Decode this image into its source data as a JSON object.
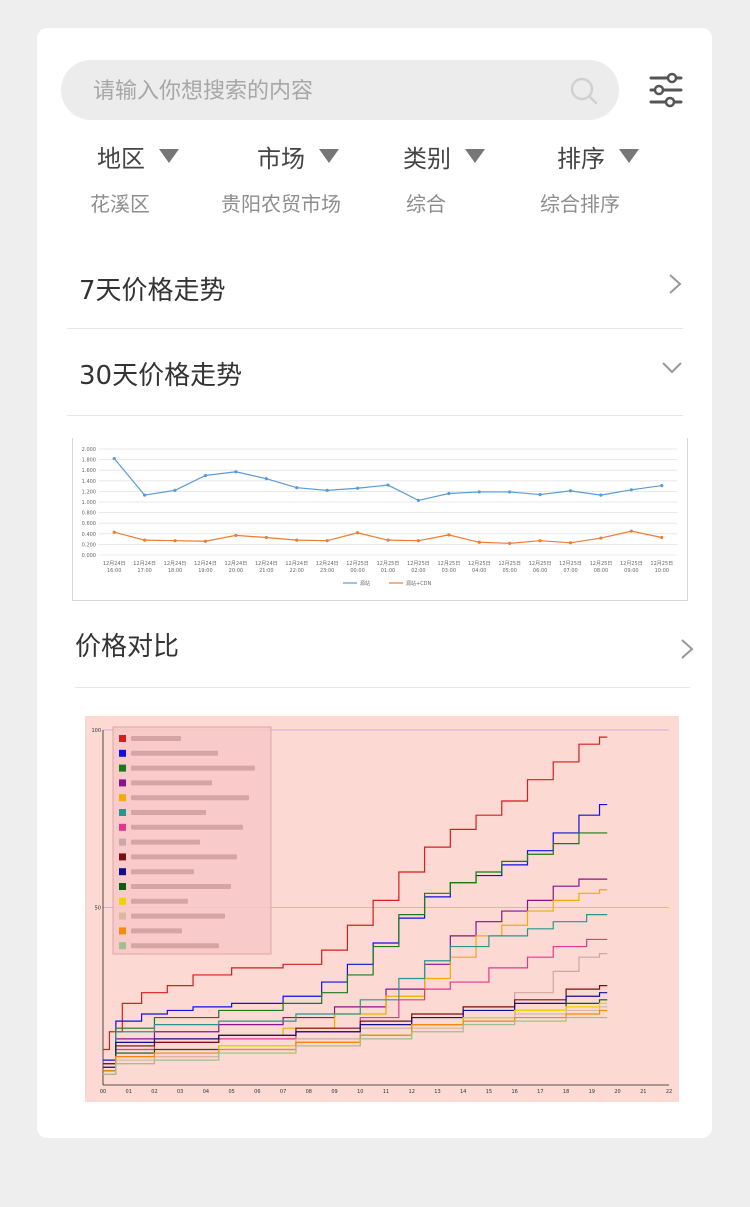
{
  "search": {
    "placeholder": "请输入你想搜索的内容"
  },
  "filters": [
    {
      "label": "地区",
      "value": "花溪区"
    },
    {
      "label": "市场",
      "value": "贵阳农贸市场"
    },
    {
      "label": "类别",
      "value": "综合"
    },
    {
      "label": "排序",
      "value": "综合排序"
    }
  ],
  "sections": {
    "seven_day": "7天价格走势",
    "thirty_day": "30天价格走势",
    "compare": "价格对比"
  },
  "colors": {
    "line_blue": "#5b9bd5",
    "line_orange": "#ed7d31",
    "chart2_bg": "#fcdad3"
  },
  "chart_data": [
    {
      "type": "line",
      "categories": [
        "12月24日 16:00",
        "12月24日 17:00",
        "12月24日 18:00",
        "12月24日 19:00",
        "12月24日 20:00",
        "12月24日 21:00",
        "12月24日 22:00",
        "12月24日 23:00",
        "12月25日 00:00",
        "12月25日 01:00",
        "12月25日 02:00",
        "12月25日 03:00",
        "12月25日 04:00",
        "12月25日 05:00",
        "12月25日 06:00",
        "12月25日 07:00",
        "12月25日 08:00",
        "12月25日 09:00",
        "12月25日 10:00"
      ],
      "yticks": [
        "2.000",
        "1.800",
        "1.600",
        "1.400",
        "1.200",
        "1.000",
        "0.800",
        "0.600",
        "0.400",
        "0.200",
        "0.000"
      ],
      "ylim": [
        0,
        2.0
      ],
      "series": [
        {
          "name": "源站",
          "color": "#5b9bd5",
          "values": [
            1.82,
            1.13,
            1.22,
            1.5,
            1.57,
            1.44,
            1.27,
            1.22,
            1.26,
            1.32,
            1.03,
            1.16,
            1.19,
            1.19,
            1.14,
            1.21,
            1.13,
            1.23,
            1.31
          ]
        },
        {
          "name": "源站+CDN",
          "color": "#ed7d31",
          "values": [
            0.43,
            0.28,
            0.27,
            0.26,
            0.37,
            0.33,
            0.28,
            0.27,
            0.42,
            0.28,
            0.27,
            0.38,
            0.24,
            0.22,
            0.27,
            0.23,
            0.32,
            0.45,
            0.33
          ]
        }
      ],
      "legend_position": "bottom"
    },
    {
      "type": "line",
      "xticks": [
        "00",
        "01",
        "02",
        "03",
        "04",
        "05",
        "06",
        "07",
        "08",
        "09",
        "10",
        "11",
        "12",
        "13",
        "14",
        "15",
        "16",
        "17",
        "18",
        "19",
        "20",
        "21",
        "22"
      ],
      "yticks": [
        "100",
        "50"
      ],
      "xlim": [
        0,
        22
      ],
      "ylim": [
        0,
        100
      ],
      "legend_position": "top-left",
      "series": [
        {
          "color": "#d21f1f",
          "values": [
            [
              0,
              10
            ],
            [
              0.5,
              15
            ],
            [
              1,
              23
            ],
            [
              2,
              26
            ],
            [
              3,
              28
            ],
            [
              4,
              31
            ],
            [
              6,
              33
            ],
            [
              8,
              34
            ],
            [
              9,
              38
            ],
            [
              10,
              45
            ],
            [
              11,
              52
            ],
            [
              12,
              60
            ],
            [
              13,
              67
            ],
            [
              14,
              72
            ],
            [
              15,
              76
            ],
            [
              16,
              80
            ],
            [
              17,
              86
            ],
            [
              18,
              91
            ],
            [
              19,
              96
            ],
            [
              19.6,
              98
            ]
          ]
        },
        {
          "color": "#1010e0",
          "values": [
            [
              0,
              7
            ],
            [
              1,
              18
            ],
            [
              2,
              20
            ],
            [
              3,
              21
            ],
            [
              4,
              22
            ],
            [
              6,
              23
            ],
            [
              8,
              25
            ],
            [
              9,
              29
            ],
            [
              10,
              34
            ],
            [
              11,
              40
            ],
            [
              12,
              47
            ],
            [
              13,
              53
            ],
            [
              14,
              57
            ],
            [
              15,
              59
            ],
            [
              16,
              62
            ],
            [
              17,
              66
            ],
            [
              18,
              71
            ],
            [
              19,
              76
            ],
            [
              19.6,
              79
            ]
          ]
        },
        {
          "color": "#1a7a1a",
          "values": [
            [
              0,
              6
            ],
            [
              1,
              16
            ],
            [
              3,
              19
            ],
            [
              6,
              21
            ],
            [
              8,
              23
            ],
            [
              9,
              26
            ],
            [
              10,
              31
            ],
            [
              11,
              39
            ],
            [
              12,
              48
            ],
            [
              13,
              54
            ],
            [
              14,
              57
            ],
            [
              15,
              60
            ],
            [
              16,
              63
            ],
            [
              17,
              65
            ],
            [
              18,
              68
            ],
            [
              19,
              71
            ],
            [
              19.6,
              71
            ]
          ]
        },
        {
          "color": "#8a128a",
          "values": [
            [
              0,
              6
            ],
            [
              1,
              13
            ],
            [
              3,
              15
            ],
            [
              6,
              17
            ],
            [
              8,
              19
            ],
            [
              10,
              22
            ],
            [
              12,
              27
            ],
            [
              13,
              34
            ],
            [
              14,
              42
            ],
            [
              15,
              46
            ],
            [
              16,
              49
            ],
            [
              17,
              52
            ],
            [
              18,
              56
            ],
            [
              19,
              58
            ],
            [
              19.6,
              58
            ]
          ]
        },
        {
          "color": "#f2ad00",
          "values": [
            [
              0,
              5
            ],
            [
              1,
              11
            ],
            [
              3,
              13
            ],
            [
              6,
              14
            ],
            [
              8,
              16
            ],
            [
              10,
              20
            ],
            [
              12,
              25
            ],
            [
              13,
              30
            ],
            [
              14,
              36
            ],
            [
              15,
              42
            ],
            [
              16,
              45
            ],
            [
              17,
              49
            ],
            [
              18,
              52
            ],
            [
              19,
              54
            ],
            [
              19.6,
              55
            ]
          ]
        },
        {
          "color": "#27968f",
          "values": [
            [
              0,
              6
            ],
            [
              1,
              15
            ],
            [
              3,
              17
            ],
            [
              6,
              18
            ],
            [
              9,
              20
            ],
            [
              11,
              24
            ],
            [
              12,
              30
            ],
            [
              13,
              35
            ],
            [
              14,
              39
            ],
            [
              16,
              42
            ],
            [
              17,
              44
            ],
            [
              18,
              46
            ],
            [
              19.6,
              48
            ]
          ]
        },
        {
          "color": "#e0388f",
          "values": [
            [
              0,
              4
            ],
            [
              1,
              10
            ],
            [
              3,
              12
            ],
            [
              6,
              13
            ],
            [
              9,
              15
            ],
            [
              11,
              19
            ],
            [
              12,
              24
            ],
            [
              13,
              27
            ],
            [
              14,
              29
            ],
            [
              16,
              33
            ],
            [
              17,
              36
            ],
            [
              18,
              39
            ],
            [
              19.6,
              41
            ]
          ]
        },
        {
          "color": "#c9a9a5",
          "values": [
            [
              0,
              3
            ],
            [
              1,
              6
            ],
            [
              3,
              8
            ],
            [
              6,
              10
            ],
            [
              9,
              13
            ],
            [
              11,
              16
            ],
            [
              13,
              19
            ],
            [
              15,
              22
            ],
            [
              17,
              26
            ],
            [
              18,
              32
            ],
            [
              19,
              36
            ],
            [
              19.6,
              37
            ]
          ]
        },
        {
          "color": "#7a0f0f",
          "values": [
            [
              0,
              6
            ],
            [
              1,
              11
            ],
            [
              3,
              12
            ],
            [
              6,
              14
            ],
            [
              9,
              16
            ],
            [
              11,
              18
            ],
            [
              13,
              20
            ],
            [
              15,
              22
            ],
            [
              17,
              24
            ],
            [
              19,
              27
            ],
            [
              19.6,
              28
            ]
          ]
        },
        {
          "color": "#10108a",
          "values": [
            [
              0,
              5
            ],
            [
              1,
              12
            ],
            [
              3,
              13
            ],
            [
              6,
              14
            ],
            [
              9,
              15
            ],
            [
              11,
              17
            ],
            [
              13,
              19
            ],
            [
              15,
              21
            ],
            [
              17,
              23
            ],
            [
              19,
              25
            ],
            [
              19.6,
              26
            ]
          ]
        },
        {
          "color": "#0b5e0b",
          "values": [
            [
              0,
              4
            ],
            [
              1,
              9
            ],
            [
              3,
              10
            ],
            [
              6,
              11
            ],
            [
              9,
              12
            ],
            [
              11,
              14
            ],
            [
              13,
              17
            ],
            [
              15,
              19
            ],
            [
              17,
              21
            ],
            [
              19,
              23
            ],
            [
              19.6,
              24
            ]
          ]
        },
        {
          "color": "#f0d200",
          "values": [
            [
              0,
              3
            ],
            [
              1,
              8
            ],
            [
              3,
              9
            ],
            [
              6,
              11
            ],
            [
              9,
              12
            ],
            [
              11,
              14
            ],
            [
              13,
              17
            ],
            [
              15,
              19
            ],
            [
              17,
              21
            ],
            [
              19,
              22
            ],
            [
              19.6,
              23
            ]
          ]
        },
        {
          "color": "#d9b7a0",
          "values": [
            [
              0,
              3
            ],
            [
              1,
              7
            ],
            [
              3,
              8
            ],
            [
              6,
              9
            ],
            [
              9,
              11
            ],
            [
              11,
              13
            ],
            [
              13,
              16
            ],
            [
              15,
              18
            ],
            [
              17,
              20
            ],
            [
              19,
              21
            ],
            [
              19.6,
              22
            ]
          ]
        },
        {
          "color": "#f58a0a",
          "values": [
            [
              0,
              4
            ],
            [
              1,
              8
            ],
            [
              3,
              9
            ],
            [
              6,
              10
            ],
            [
              9,
              12
            ],
            [
              11,
              14
            ],
            [
              13,
              17
            ],
            [
              15,
              18
            ],
            [
              17,
              19
            ],
            [
              19,
              20
            ],
            [
              19.6,
              21
            ]
          ]
        },
        {
          "color": "#9fbf8f",
          "values": [
            [
              0,
              3
            ],
            [
              1,
              6
            ],
            [
              3,
              7
            ],
            [
              6,
              9
            ],
            [
              9,
              11
            ],
            [
              11,
              13
            ],
            [
              13,
              15
            ],
            [
              15,
              17
            ],
            [
              17,
              18
            ],
            [
              19,
              19
            ],
            [
              19.6,
              19
            ]
          ]
        }
      ]
    }
  ]
}
